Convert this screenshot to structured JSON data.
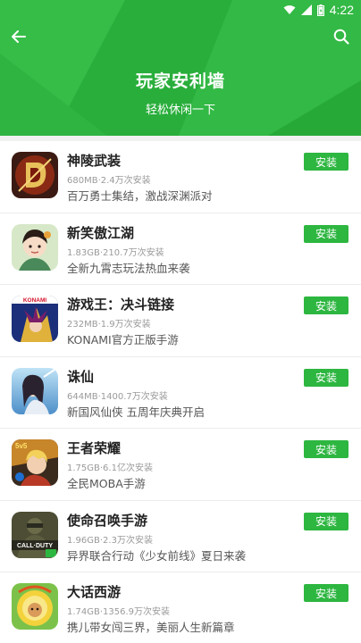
{
  "status_bar": {
    "time": "4:22",
    "icons": [
      "wifi-icon",
      "signal-icon",
      "battery-icon"
    ]
  },
  "header": {
    "title": "玩家安利墙",
    "subtitle": "轻松休闲一下",
    "back_icon": "arrow-left-icon",
    "search_icon": "search-icon",
    "bg_color": "#2db640"
  },
  "colors": {
    "accent": "#2db640",
    "name_text": "#222222",
    "meta_text": "#9a9a9a",
    "desc_text": "#555555"
  },
  "apps": [
    {
      "name": "神陵武装",
      "meta": "680MB·2.4万次安装",
      "desc": "百万勇士集结，激战深渊派对",
      "button": "安装",
      "icon": "shenling-game-icon"
    },
    {
      "name": "新笑傲江湖",
      "meta": "1.83GB·210.7万次安装",
      "desc": "全新九霄志玩法热血来袭",
      "button": "安装",
      "icon": "xiaoao-game-icon"
    },
    {
      "name": "游戏王：决斗链接",
      "meta": "232MB·1.9万次安装",
      "desc": "KONAMI官方正版手游",
      "button": "安装",
      "icon": "yugioh-game-icon",
      "icon_text": "KONAMI"
    },
    {
      "name": "诛仙",
      "meta": "644MB·1400.7万次安装",
      "desc": "新国风仙侠 五周年庆典开启",
      "button": "安装",
      "icon": "zhuxian-game-icon"
    },
    {
      "name": "王者荣耀",
      "meta": "1.75GB·6.1亿次安装",
      "desc": "全民MOBA手游",
      "button": "安装",
      "icon": "honor-of-kings-icon",
      "icon_text": "5v5"
    },
    {
      "name": "使命召唤手游",
      "meta": "1.96GB·2.3万次安装",
      "desc": "异界联合行动《少女前线》夏日来袭",
      "button": "安装",
      "icon": "call-of-duty-icon",
      "icon_text": "CALL·DUTY"
    },
    {
      "name": "大话西游",
      "meta": "1.74GB·1356.9万次安装",
      "desc": "携儿带女闯三界，美丽人生新篇章",
      "button": "安装",
      "icon": "dahua-xiyou-icon"
    }
  ]
}
